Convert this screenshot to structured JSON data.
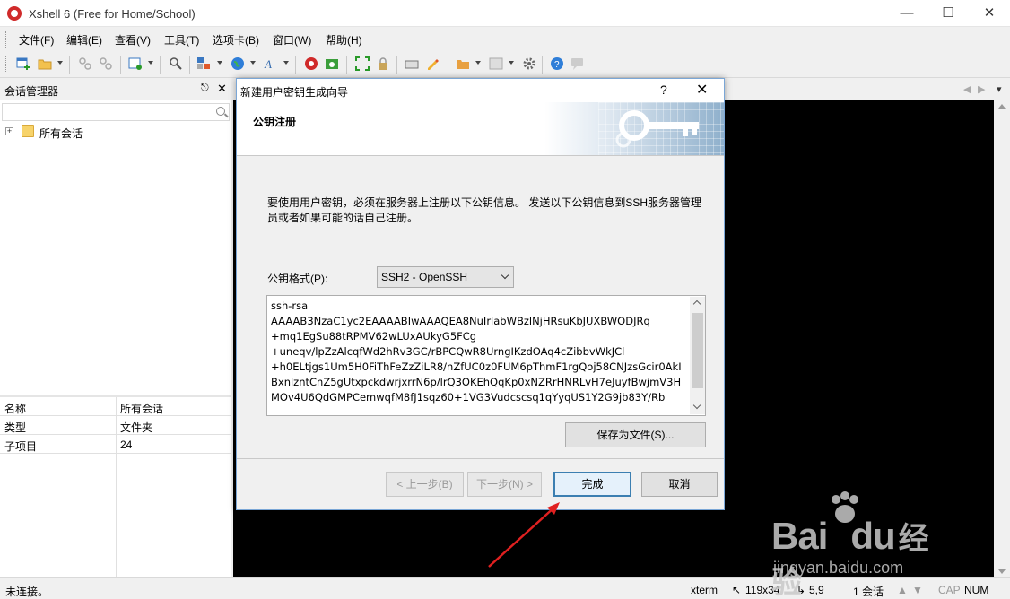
{
  "window": {
    "title": "Xshell 6 (Free for Home/School)"
  },
  "menu": [
    "文件(F)",
    "编辑(E)",
    "查看(V)",
    "工具(T)",
    "选项卡(B)",
    "窗口(W)",
    "帮助(H)"
  ],
  "sidebar": {
    "title": "会话管理器",
    "tree": [
      {
        "label": "所有会话"
      }
    ],
    "properties": [
      {
        "key": "名称",
        "value": "所有会话"
      },
      {
        "key": "类型",
        "value": "文件夹"
      },
      {
        "key": "子项目",
        "value": "24"
      }
    ]
  },
  "dialog": {
    "title": "新建用户密钥生成向导",
    "help": "?",
    "heading": "公钥注册",
    "description": "要使用用户密钥，必须在服务器上注册以下公钥信息。 发送以下公钥信息到SSH服务器管理员或者如果可能的话自己注册。",
    "format_label": "公钥格式(P):",
    "format_value": "SSH2 - OpenSSH",
    "key_lines": [
      "ssh-rsa",
      "AAAAB3NzaC1yc2EAAAABIwAAAQEA8NuIrlabWBzlNjHRsuKbJUXBWODJRq",
      "+mq1EgSu88tRPMV62wLUxAUkyG5FCg",
      "+uneqv/lpZzAlcqfWd2hRv3GC/rBPCQwR8UrngIKzdOAq4cZibbvWkJCl",
      "+h0ELtjgs1Um5H0FiThFeZzZiLR8/nZfUC0z0FUM6pThmF1rgQoj58CNJzsGcir0AkI",
      "BxnlzntCnZ5gUtxpckdwrjxrrN6p/lrQ3OKEhQqKp0xNZRrHNRLvH7eJuyfBwjmV3H",
      "MOv4U6QdGMPCemwqfM8fJ1sqz60+1VG3Vudcscsq1qYyqUS1Y2G9jb83Y/Rb"
    ],
    "buttons": {
      "save": "保存为文件(S)...",
      "prev": "< 上一步(B)",
      "next": "下一步(N) >",
      "finish": "完成",
      "cancel": "取消"
    }
  },
  "status": {
    "connection": "未连接。",
    "terminal": "xterm",
    "size": "119x34",
    "cursor": "5,9",
    "sessions": "1 会话",
    "cap": "CAP",
    "num": "NUM"
  },
  "watermark": {
    "main": "Bai",
    "mid": "du",
    "cn": "经验",
    "url": "jingyan.baidu.com"
  },
  "colors": {
    "arrow": "#e02020",
    "accent": "#3c7fb1",
    "terminal_bg": "#000000"
  }
}
